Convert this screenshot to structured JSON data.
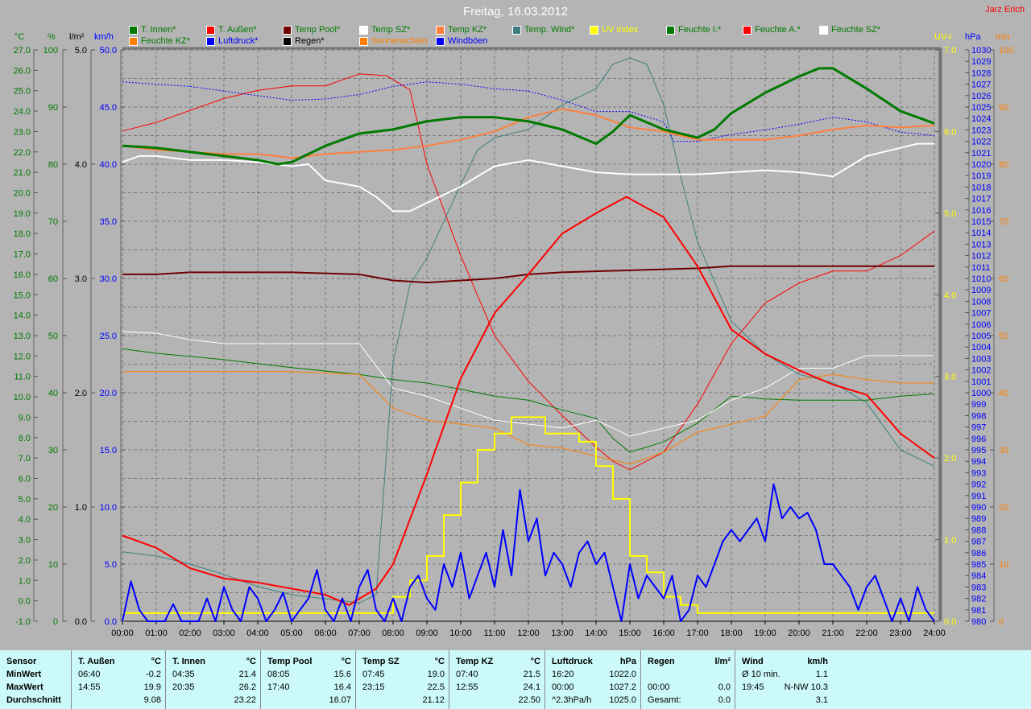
{
  "title": "Freitag, 16.03.2012",
  "author": "Jarz Erich",
  "colors": {
    "innen": "#007a00",
    "aussen": "#ff0000",
    "pool": "#700000",
    "sz": "#ffffff",
    "kz": "#ff7f3f",
    "wind_temp": "#3f7f7f",
    "uv": "#ffff00",
    "luftdruck": "#0000ff",
    "windboeen": "#0000ff",
    "sonnenschein": "#ff8000",
    "regen": "#000000"
  },
  "legend": [
    {
      "label": "T. Innen*",
      "color": "#007a00",
      "text": "#007a00"
    },
    {
      "label": "T. Außen*",
      "color": "#ff0000",
      "text": "#007a00"
    },
    {
      "label": "Temp Pool*",
      "color": "#700000",
      "text": "#007a00"
    },
    {
      "label": "Temp SZ*",
      "color": "#ffffff",
      "text": "#007a00"
    },
    {
      "label": "Temp KZ*",
      "color": "#ff7f3f",
      "text": "#007a00"
    },
    {
      "label": "Temp. Wind*",
      "color": "#3f7f7f",
      "text": "#007a00"
    },
    {
      "label": "UV Index",
      "color": "#ffff00",
      "text": "#ffff00"
    },
    {
      "label": "Feuchte I.*",
      "color": "#007a00",
      "text": "#007a00"
    },
    {
      "label": "Feuchte A.*",
      "color": "#ff0000",
      "text": "#007a00"
    },
    {
      "label": "Feuchte SZ*",
      "color": "#ffffff",
      "text": "#007a00"
    },
    {
      "label": "Feuchte KZ*",
      "color": "#ff7f00",
      "text": "#007a00"
    },
    {
      "label": "Luftdruck*",
      "color": "#0000ff",
      "text": "#0000ff"
    },
    {
      "label": "Regen*",
      "color": "#000000",
      "text": "#000000"
    },
    {
      "label": "Sonnenschein",
      "color": "#ff8000",
      "text": "#ff8000"
    },
    {
      "label": "Windböen",
      "color": "#0000ff",
      "text": "#0000ff"
    }
  ],
  "chart_data": {
    "type": "line",
    "title": "Freitag, 16.03.2012",
    "x_ticks": [
      "00:00",
      "01:00",
      "02:00",
      "03:00",
      "04:00",
      "05:00",
      "06:00",
      "07:00",
      "08:00",
      "09:00",
      "10:00",
      "11:00",
      "12:00",
      "13:00",
      "14:00",
      "15:00",
      "16:00",
      "17:00",
      "18:00",
      "19:00",
      "20:00",
      "21:00",
      "22:00",
      "23:00",
      "24:00"
    ],
    "xlim": [
      0,
      24
    ],
    "grid": true,
    "axes": {
      "temp": {
        "unit": "°C",
        "range": [
          -1,
          27
        ],
        "step": 1,
        "decimals": 1,
        "color": "#007a00",
        "side": "left"
      },
      "hum": {
        "unit": "%",
        "range": [
          0,
          100
        ],
        "step": 10,
        "decimals": 0,
        "color": "#007a00",
        "side": "left"
      },
      "rain": {
        "unit": "l/m²",
        "range": [
          0,
          5
        ],
        "step": 1,
        "decimals": 1,
        "color": "#000000",
        "side": "left"
      },
      "wind": {
        "unit": "km/h",
        "range": [
          0,
          50
        ],
        "step": 5,
        "decimals": 1,
        "color": "#0000ff",
        "side": "left"
      },
      "uv": {
        "unit": "UV-I",
        "range": [
          0,
          7
        ],
        "step": 1,
        "decimals": 1,
        "color": "#ffff00",
        "side": "right"
      },
      "press": {
        "unit": "hPa",
        "range": [
          980,
          1030
        ],
        "step": 1,
        "decimals": 0,
        "color": "#0000ff",
        "side": "right"
      },
      "sun": {
        "unit": "min",
        "range": [
          0,
          100
        ],
        "step": 10,
        "decimals": 0,
        "color": "#ff8000",
        "side": "right"
      }
    },
    "series": [
      {
        "name": "Feuchte A.",
        "axis": "hum",
        "color": "#ff0000",
        "width": 1,
        "x": [
          0,
          1,
          2,
          3,
          4,
          5,
          6,
          7,
          7.8,
          8.5,
          9,
          10,
          11,
          12,
          13,
          14,
          14.5,
          15,
          16,
          17,
          18,
          19,
          20,
          21,
          22,
          23,
          24
        ],
        "y": [
          85.8,
          87.3,
          89.4,
          91.5,
          92.9,
          93.7,
          93.7,
          95.8,
          95.5,
          93,
          80,
          64,
          50,
          42,
          36,
          30.5,
          28,
          26.5,
          29.6,
          38,
          48.6,
          55.7,
          59.2,
          61.3,
          61.3,
          64,
          68.3
        ]
      },
      {
        "name": "Feuchte I.",
        "axis": "hum",
        "color": "#007a00",
        "width": 1,
        "x": [
          0,
          1,
          3,
          5,
          7,
          8,
          9,
          10,
          11,
          12,
          13,
          14,
          14.5,
          15,
          16,
          17,
          18,
          19,
          20,
          21,
          22,
          23,
          24
        ],
        "y": [
          47.7,
          46.9,
          45.8,
          44.4,
          43.2,
          42.3,
          41.7,
          40.6,
          39.4,
          38.7,
          37,
          35.5,
          32,
          29.6,
          31.4,
          34.7,
          39.4,
          38.9,
          38.7,
          38.7,
          38.7,
          39.4,
          39.8
        ]
      },
      {
        "name": "Feuchte SZ",
        "axis": "hum",
        "color": "#ffffff",
        "width": 1,
        "x": [
          0,
          1,
          2,
          3,
          4,
          5,
          6,
          7,
          8,
          9,
          10,
          11,
          12,
          13,
          14,
          15,
          16,
          17,
          18,
          19,
          20,
          21,
          22,
          23,
          24
        ],
        "y": [
          50.7,
          50.4,
          49.3,
          48.6,
          48.6,
          48.6,
          48.6,
          48.6,
          40.8,
          39.4,
          37.3,
          35.2,
          34.5,
          33.8,
          35.2,
          32.4,
          33.8,
          35.2,
          38.7,
          40.8,
          44.3,
          44.3,
          46.5,
          46.5,
          46.5
        ]
      },
      {
        "name": "Feuchte KZ",
        "axis": "hum",
        "color": "#ff7f00",
        "width": 1,
        "x": [
          0,
          1,
          3,
          5,
          7,
          8,
          9,
          10,
          11,
          12,
          13,
          14,
          15,
          16,
          17,
          18,
          19,
          20,
          21,
          22,
          23,
          24
        ],
        "y": [
          43.7,
          43.7,
          43.7,
          43.7,
          43.2,
          37.3,
          35.2,
          34.5,
          33.8,
          30.9,
          30.3,
          28.9,
          27.5,
          29.6,
          33.1,
          34.5,
          35.9,
          42.3,
          43.2,
          42.3,
          41.7,
          41.7
        ]
      },
      {
        "name": "Temp. Wind",
        "axis": "temp",
        "color": "#3f7f7f",
        "width": 1,
        "x": [
          0,
          1,
          2,
          3,
          4,
          5,
          6,
          7,
          7.5,
          8,
          8.5,
          9,
          10,
          10.5,
          11,
          12,
          13,
          14,
          14.5,
          15,
          15.5,
          16,
          16.5,
          17,
          18,
          19,
          20,
          21,
          22,
          23,
          24
        ],
        "y": [
          2.4,
          2.2,
          1.8,
          1.3,
          0.7,
          0.3,
          0.1,
          -0.1,
          0.3,
          11.7,
          15.5,
          16.8,
          20.4,
          22.1,
          22.7,
          23.1,
          24.3,
          25.1,
          26.3,
          26.6,
          26.3,
          24.3,
          20.8,
          17.6,
          13.7,
          12.1,
          11.1,
          10.7,
          9.7,
          7.4,
          6.6
        ]
      },
      {
        "name": "Luftdruck",
        "axis": "press",
        "color": "#0000ff",
        "width": 1,
        "dash": "2,2",
        "x": [
          0,
          2,
          4,
          5,
          6,
          7,
          8,
          9,
          10,
          11,
          12,
          13,
          14,
          15,
          16,
          16.3,
          17,
          18,
          19,
          20,
          21,
          22,
          23,
          24
        ],
        "y": [
          1027.2,
          1026.8,
          1026,
          1025.6,
          1025.7,
          1026.1,
          1026.8,
          1027.2,
          1027,
          1026.6,
          1026.4,
          1025.6,
          1024.6,
          1024.6,
          1023.7,
          1022,
          1022,
          1022.6,
          1023,
          1023.5,
          1024.1,
          1023.7,
          1022.8,
          1022.5
        ]
      },
      {
        "name": "Temp Pool",
        "axis": "temp",
        "color": "#700000",
        "width": 2,
        "x": [
          0,
          1,
          2,
          5,
          7,
          8,
          9,
          10,
          11,
          12,
          13,
          15,
          17,
          18,
          24
        ],
        "y": [
          16,
          16,
          16.1,
          16.1,
          16,
          15.7,
          15.6,
          15.7,
          15.8,
          16,
          16.1,
          16.2,
          16.3,
          16.4,
          16.4
        ]
      },
      {
        "name": "Temp SZ",
        "axis": "temp",
        "color": "#ffffff",
        "width": 2,
        "x": [
          0,
          0.5,
          1,
          2,
          3,
          4,
          5,
          5.5,
          6,
          7,
          7.5,
          8,
          8.5,
          9,
          10,
          11,
          12,
          13,
          14,
          15,
          16,
          17,
          18,
          19,
          20,
          21,
          21.3,
          22,
          23,
          23.5,
          24
        ],
        "y": [
          21.5,
          21.8,
          21.8,
          21.6,
          21.6,
          21.5,
          21.3,
          21.4,
          20.6,
          20.3,
          19.8,
          19.1,
          19.1,
          19.5,
          20.3,
          21.3,
          21.6,
          21.3,
          21,
          20.9,
          20.9,
          20.9,
          21,
          21.1,
          21,
          20.8,
          21.1,
          21.8,
          22.2,
          22.4,
          22.4
        ]
      },
      {
        "name": "Temp KZ",
        "axis": "temp",
        "color": "#ff7f3f",
        "width": 2,
        "x": [
          0,
          1,
          2,
          3,
          4,
          5,
          6,
          7,
          8,
          9,
          10,
          11,
          12,
          13,
          14,
          15,
          16,
          17,
          18,
          19,
          20,
          21,
          22,
          23,
          24
        ],
        "y": [
          22.3,
          22.1,
          22,
          21.9,
          21.9,
          21.7,
          21.9,
          22,
          22.1,
          22.3,
          22.6,
          23,
          23.7,
          24.1,
          23.8,
          23.2,
          23,
          22.6,
          22.6,
          22.6,
          22.8,
          23.1,
          23.3,
          23.2,
          23.3
        ]
      },
      {
        "name": "T. Innen",
        "axis": "temp",
        "color": "#007a00",
        "width": 3,
        "x": [
          0,
          1,
          2,
          3,
          4,
          4.6,
          5,
          6,
          7,
          8,
          9,
          10,
          11,
          12,
          13,
          14,
          14.5,
          15,
          16,
          17,
          17.5,
          18,
          19,
          20,
          20.6,
          21,
          22,
          23,
          24
        ],
        "y": [
          22.3,
          22.2,
          22,
          21.8,
          21.6,
          21.4,
          21.5,
          22.3,
          22.9,
          23.1,
          23.5,
          23.7,
          23.7,
          23.5,
          23.1,
          22.4,
          23,
          23.8,
          23.1,
          22.7,
          23.1,
          23.9,
          24.9,
          25.7,
          26.1,
          26.1,
          25.1,
          24,
          23.4
        ]
      },
      {
        "name": "T. Außen",
        "axis": "temp",
        "color": "#ff0000",
        "width": 2,
        "x": [
          0,
          1,
          2,
          3,
          4,
          5,
          6,
          6.7,
          7,
          7.5,
          8,
          9,
          10,
          11,
          12,
          13,
          14,
          14.9,
          16,
          17,
          18,
          19,
          20,
          21,
          22,
          23,
          24
        ],
        "y": [
          3.2,
          2.6,
          1.6,
          1.1,
          0.9,
          0.6,
          0.3,
          -0.2,
          0.1,
          0.6,
          1.8,
          6.2,
          10.9,
          14.1,
          16,
          18,
          19,
          19.8,
          18.8,
          16.4,
          13.3,
          12.1,
          11.3,
          10.6,
          10.1,
          8.2,
          7
        ]
      },
      {
        "name": "UV Index",
        "axis": "uv",
        "color": "#ffff00",
        "width": 2,
        "step": true,
        "x": [
          0,
          7.5,
          8,
          8.5,
          9,
          9.5,
          10,
          10.5,
          11,
          11.5,
          12,
          12.5,
          13,
          13.5,
          14,
          14.5,
          15,
          15.5,
          16,
          16.5,
          17,
          24
        ],
        "y": [
          0.1,
          0.1,
          0.3,
          0.5,
          0.8,
          1.3,
          1.7,
          2.1,
          2.3,
          2.5,
          2.5,
          2.3,
          2.3,
          2.2,
          1.9,
          1.5,
          0.8,
          0.6,
          0.3,
          0.2,
          0.1,
          0.1
        ]
      },
      {
        "name": "Windböen",
        "axis": "wind",
        "color": "#0000ff",
        "width": 2,
        "x_step": 0.25,
        "y": [
          0,
          3.5,
          1,
          0,
          0,
          0,
          1.5,
          0,
          0,
          0,
          2,
          0,
          3,
          1,
          0,
          3,
          2,
          0,
          1,
          2.5,
          0,
          1,
          2,
          4.5,
          1,
          0,
          2,
          0,
          3,
          4.5,
          1,
          0,
          2,
          0,
          3,
          4,
          2,
          1,
          5,
          3,
          6,
          2,
          4,
          6,
          3,
          8,
          4,
          11.5,
          7,
          9,
          4,
          6,
          5,
          3,
          6,
          7,
          5,
          6,
          3,
          0,
          5,
          2,
          4,
          3,
          2,
          4,
          0,
          1,
          4,
          3,
          5,
          7,
          8,
          7,
          8,
          9,
          7,
          12,
          9,
          10,
          9,
          9.5,
          8,
          5,
          5,
          4,
          3,
          1,
          3,
          4,
          2,
          0,
          2,
          0,
          3,
          1,
          0
        ]
      }
    ]
  },
  "stats": {
    "row_labels": [
      "Sensor",
      "MinWert",
      "MaxWert",
      "Durchschnitt"
    ],
    "columns": [
      {
        "name": "T. Außen",
        "unit": "°C",
        "rows": [
          [
            "06:40",
            "-0.2"
          ],
          [
            "14:55",
            "19.9"
          ],
          [
            "",
            "9.08"
          ]
        ]
      },
      {
        "name": "T. Innen",
        "unit": "°C",
        "rows": [
          [
            "04:35",
            "21.4"
          ],
          [
            "20:35",
            "26.2"
          ],
          [
            "",
            "23.22"
          ]
        ]
      },
      {
        "name": "Temp Pool",
        "unit": "°C",
        "rows": [
          [
            "08:05",
            "15.6"
          ],
          [
            "17:40",
            "16.4"
          ],
          [
            "",
            "16.07"
          ]
        ]
      },
      {
        "name": "Temp SZ",
        "unit": "°C",
        "rows": [
          [
            "07:45",
            "19.0"
          ],
          [
            "23:15",
            "22.5"
          ],
          [
            "",
            "21.12"
          ]
        ]
      },
      {
        "name": "Temp KZ",
        "unit": "°C",
        "rows": [
          [
            "07:40",
            "21.5"
          ],
          [
            "12:55",
            "24.1"
          ],
          [
            "",
            "22.50"
          ]
        ]
      },
      {
        "name": "Luftdruck",
        "unit": "hPa",
        "rows": [
          [
            "16:20",
            "1022.0"
          ],
          [
            "00:00",
            "1027.2"
          ],
          [
            "^2.3hPa/h",
            "1025.0"
          ]
        ]
      },
      {
        "name": "Regen",
        "unit": "l/m²",
        "rows": [
          [
            "",
            ""
          ],
          [
            "00:00",
            "0.0"
          ],
          [
            "Gesamt:",
            "0.0"
          ]
        ]
      },
      {
        "name": "Wind",
        "unit": "km/h",
        "rows": [
          [
            "Ø 10 min.",
            "1.1"
          ],
          [
            "19:45",
            "N-NW 10.3"
          ],
          [
            "",
            "3.1"
          ]
        ]
      }
    ]
  }
}
